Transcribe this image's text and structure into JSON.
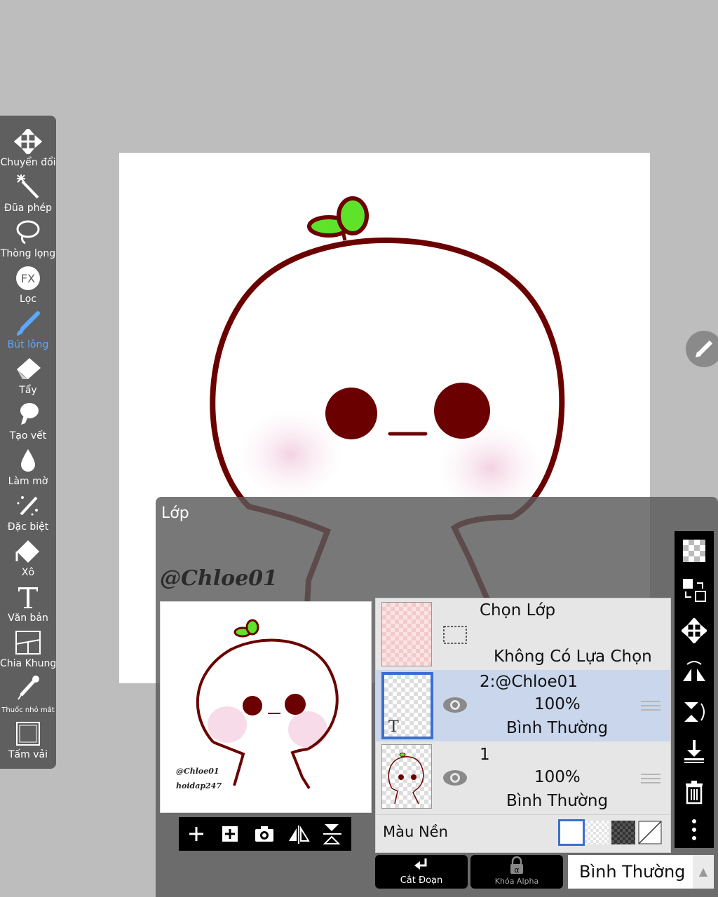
{
  "toolbar": {
    "items": [
      {
        "label": "Chuyển đổi",
        "icon": "move-arrows-icon"
      },
      {
        "label": "Đũa phép",
        "icon": "magic-wand-icon"
      },
      {
        "label": "Thòng lọng",
        "icon": "lasso-icon"
      },
      {
        "label": "Lọc",
        "icon": "fx-filter-icon"
      },
      {
        "label": "Bút lông",
        "icon": "brush-icon"
      },
      {
        "label": "Tẩy",
        "icon": "eraser-icon"
      },
      {
        "label": "Tạo vết",
        "icon": "smudge-icon"
      },
      {
        "label": "Làm mờ",
        "icon": "blur-drop-icon"
      },
      {
        "label": "Đặc biệt",
        "icon": "special-wand-icon"
      },
      {
        "label": "Xô",
        "icon": "bucket-icon"
      },
      {
        "label": "Văn bản",
        "icon": "text-tool-icon"
      },
      {
        "label": "Chia Khung",
        "icon": "frame-divide-icon"
      },
      {
        "label": "Thuốc nhỏ mắt",
        "icon": "eyedropper-icon"
      },
      {
        "label": "Tấm vải",
        "icon": "canvas-icon"
      }
    ],
    "fx_text": "FX",
    "active_color": "#5aa9ff"
  },
  "layer_panel": {
    "title": "Lớp",
    "watermark": "@Chloe01",
    "preview_caption_1": "@Chloe01",
    "preview_caption_2": "hoidap247",
    "selection_row": {
      "title": "Chọn Lớp",
      "status": "Không Có Lựa Chọn"
    },
    "layers": [
      {
        "name": "2:@Chloe01",
        "opacity": "100%",
        "blend": "Bình Thường",
        "type_glyph": "T",
        "selected": true
      },
      {
        "name": "1",
        "opacity": "100%",
        "blend": "Bình Thường",
        "selected": false
      }
    ],
    "background_label": "Màu Nền",
    "selected_color": "#c9d6ec"
  },
  "bottom_bar": {
    "clip_label": "Cắt Đoạn",
    "alpha_lock_label": "Khóa Alpha",
    "alpha_glyph": "α",
    "blend_mode": "Bình Thường",
    "dropdown_arrow": "▲"
  },
  "colors": {
    "outline": "#6b0000",
    "sprout": "#5fe32a",
    "blush": "#f7dbe8",
    "accent": "#3b6fd0"
  }
}
